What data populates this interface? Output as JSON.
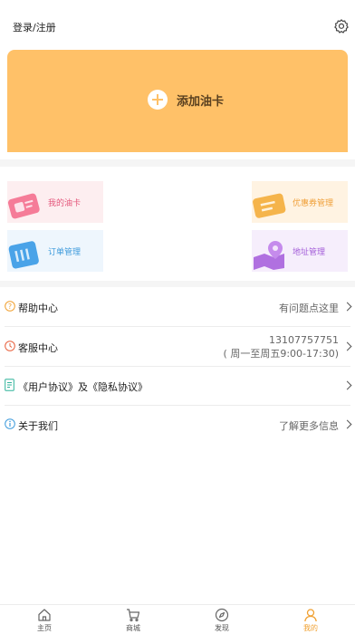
{
  "header": {
    "login_label": "登录/注册"
  },
  "banner": {
    "add_card_label": "添加油卡",
    "color": "#ffc168"
  },
  "quick_tiles": [
    {
      "label": "我的油卡",
      "color": "#e4557a"
    },
    {
      "label": "订单管理",
      "color": "#3e9bdc"
    },
    {
      "label": "优惠券管理",
      "color": "#f0a03a"
    },
    {
      "label": "地址管理",
      "color": "#a45ed9"
    }
  ],
  "menu": {
    "help": {
      "label": "帮助中心",
      "right": "有问题点这里",
      "icon": "question-circle-icon"
    },
    "service": {
      "label": "客服中心",
      "phone": "13107757751",
      "hours": "( 周一至周五9:00-17:30)",
      "icon": "clock-icon"
    },
    "agreement": {
      "label": "《用户协议》及《隐私协议》",
      "icon": "document-icon"
    },
    "about": {
      "label": "关于我们",
      "right": "了解更多信息",
      "icon": "info-circle-icon"
    }
  },
  "tabbar": {
    "items": [
      {
        "label": "主页",
        "icon": "home-icon"
      },
      {
        "label": "商城",
        "icon": "cart-icon"
      },
      {
        "label": "发现",
        "icon": "compass-icon"
      },
      {
        "label": "我的",
        "icon": "user-icon"
      }
    ],
    "active_color": "#f0a030"
  }
}
